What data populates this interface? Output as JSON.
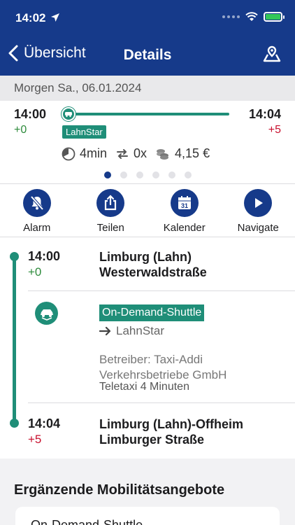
{
  "status_bar": {
    "time": "14:02"
  },
  "nav": {
    "back_label": "Übersicht",
    "title": "Details"
  },
  "date_bar": {
    "text": "Morgen Sa., 06.01.2024"
  },
  "summary": {
    "departure_time": "14:00",
    "departure_delay": "+0",
    "arrival_time": "14:04",
    "arrival_delay": "+5",
    "line_chip": "LahnStar",
    "duration": "4min",
    "transfers": "0x",
    "price": "4,15 €",
    "page_count": 6,
    "active_page": 0
  },
  "actions": [
    {
      "label": "Alarm",
      "icon": "alarm-off-icon"
    },
    {
      "label": "Teilen",
      "icon": "share-icon"
    },
    {
      "label": "Kalender",
      "icon": "calendar-icon"
    },
    {
      "label": "Navigate",
      "icon": "play-icon"
    }
  ],
  "calendar_day": "31",
  "itinerary": {
    "origin": {
      "time": "14:00",
      "delay": "+0",
      "name_line1": "Limburg (Lahn)",
      "name_line2": "Westerwaldstraße"
    },
    "leg": {
      "type_chip": "On-Demand-Shuttle",
      "destination": "LahnStar",
      "operator_line1": "Betreiber: Taxi-Addi",
      "operator_line2": "Verkehrsbetriebe GmbH",
      "note": "Teletaxi 4 Minuten"
    },
    "destination": {
      "time": "14:04",
      "delay": "+5",
      "name_line1": "Limburg (Lahn)-Offheim",
      "name_line2": "Limburger Straße"
    }
  },
  "mobility": {
    "section_title": "Ergänzende Mobilitätsangebote",
    "card_label": "On-Demand-Shuttle"
  },
  "colors": {
    "primary": "#163a8a",
    "accent": "#1f8e78",
    "on_time": "#2e8b3c",
    "delay": "#c8102e"
  }
}
